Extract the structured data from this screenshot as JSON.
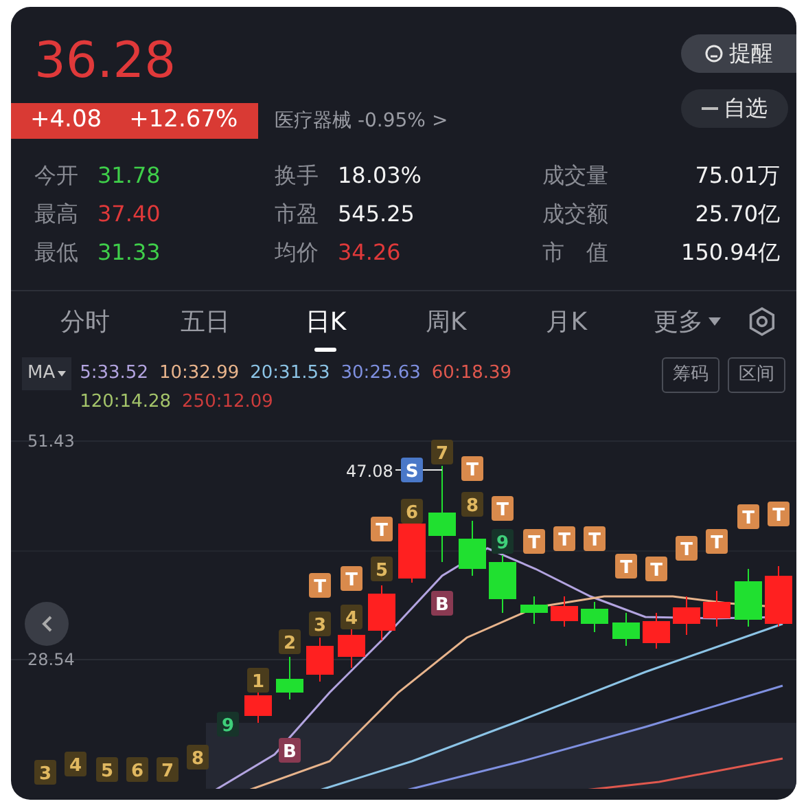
{
  "quote": {
    "price": "36.28",
    "change": "+4.08",
    "change_pct": "+12.67%",
    "sector": "医疗器械",
    "sector_change": "-0.95%",
    "sector_arrow": ">"
  },
  "actions": [
    {
      "kind": "alert",
      "label": "提醒"
    },
    {
      "kind": "remove",
      "label": "自选"
    }
  ],
  "stats": [
    {
      "label": "今开",
      "value": "31.78",
      "color": "#3fcf4a"
    },
    {
      "label": "换手",
      "value": "18.03%",
      "color": "#f2f2f2"
    },
    {
      "label": "成交量",
      "value": "75.01万",
      "color": "#f2f2f2"
    },
    {
      "label": "最高",
      "value": "37.40",
      "color": "#e0393a"
    },
    {
      "label": "市盈",
      "value": "545.25",
      "color": "#f2f2f2"
    },
    {
      "label": "成交额",
      "value": "25.70亿",
      "color": "#f2f2f2"
    },
    {
      "label": "最低",
      "value": "31.33",
      "color": "#3fcf4a"
    },
    {
      "label": "均价",
      "value": "34.26",
      "color": "#e0393a"
    },
    {
      "label": "市　值",
      "value": "150.94亿",
      "color": "#f2f2f2"
    }
  ],
  "tabs": [
    {
      "label": "分时",
      "selected": false
    },
    {
      "label": "五日",
      "selected": false
    },
    {
      "label": "日K",
      "selected": true
    },
    {
      "label": "周K",
      "selected": false
    },
    {
      "label": "月K",
      "selected": false
    },
    {
      "label": "更多",
      "selected": false,
      "dropdown": true
    }
  ],
  "ma": {
    "label": "MA",
    "values": [
      {
        "text": "5:33.52",
        "color": "#b3a4e0"
      },
      {
        "text": "10:32.99",
        "color": "#e8b48c"
      },
      {
        "text": "20:31.53",
        "color": "#8cc4e6"
      },
      {
        "text": "30:25.63",
        "color": "#7f90e0"
      },
      {
        "text": "60:18.39",
        "color": "#e0584e"
      },
      {
        "text": "120:14.28",
        "color": "#a4c46a"
      },
      {
        "text": "250:12.09",
        "color": "#cc3c3c"
      }
    ]
  },
  "chart_buttons": [
    "筹码",
    "区间"
  ],
  "chart": {
    "y_labels": [
      "51.43",
      "28.54"
    ],
    "high_label": "47.08",
    "markers": [
      {
        "label": "3",
        "kind": "count"
      },
      {
        "label": "4",
        "kind": "count"
      },
      {
        "label": "5",
        "kind": "count"
      },
      {
        "label": "6",
        "kind": "count"
      },
      {
        "label": "7",
        "kind": "count"
      },
      {
        "label": "8",
        "kind": "count"
      },
      {
        "label": "9",
        "kind": "green"
      },
      {
        "label": "1",
        "kind": "count"
      },
      {
        "label": "2",
        "kind": "count"
      },
      {
        "label": "3",
        "kind": "count"
      },
      {
        "label": "4",
        "kind": "count"
      },
      {
        "label": "5",
        "kind": "count"
      },
      {
        "label": "6",
        "kind": "count"
      },
      {
        "label": "7",
        "kind": "count"
      },
      {
        "label": "8",
        "kind": "count"
      },
      {
        "label": "9",
        "kind": "green"
      },
      {
        "label": "B",
        "kind": "buy"
      },
      {
        "label": "B",
        "kind": "buy"
      },
      {
        "label": "S",
        "kind": "sell"
      },
      {
        "label": "T",
        "kind": "tag"
      },
      {
        "label": "T",
        "kind": "tag"
      },
      {
        "label": "T",
        "kind": "tag"
      },
      {
        "label": "T",
        "kind": "tag"
      },
      {
        "label": "T",
        "kind": "tag"
      },
      {
        "label": "T",
        "kind": "tag"
      },
      {
        "label": "T",
        "kind": "tag"
      },
      {
        "label": "T",
        "kind": "tag"
      },
      {
        "label": "T",
        "kind": "tag"
      },
      {
        "label": "T",
        "kind": "tag"
      },
      {
        "label": "T",
        "kind": "tag"
      },
      {
        "label": "T",
        "kind": "tag"
      },
      {
        "label": "T",
        "kind": "tag"
      },
      {
        "label": "T",
        "kind": "tag"
      }
    ]
  }
}
